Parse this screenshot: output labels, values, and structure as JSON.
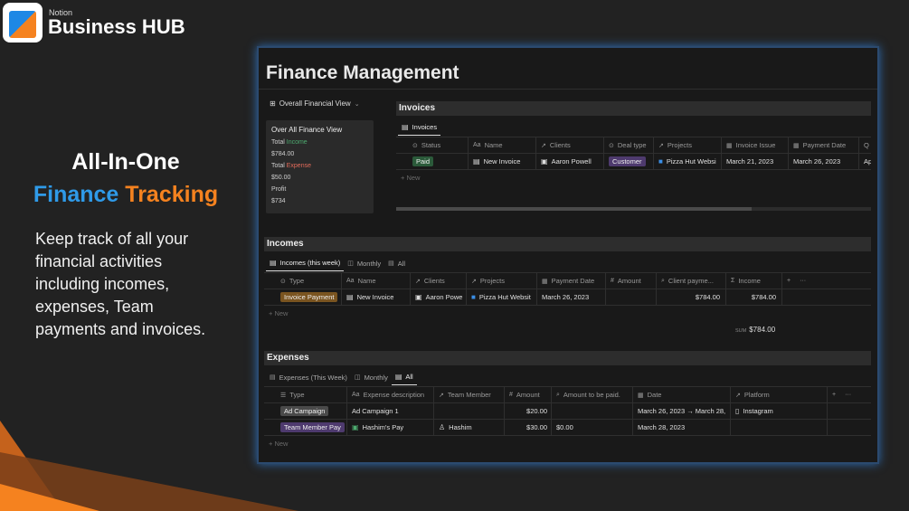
{
  "brand": {
    "small": "Notion",
    "name": "Business HUB"
  },
  "hero": {
    "line1": "All-In-One",
    "line2_a": "Finance",
    "line2_b": "Tracking",
    "description": "Keep track of all your financial activities including incomes, expenses, Team payments and invoices."
  },
  "colors": {
    "accent_blue": "#2f9ae8",
    "accent_orange": "#f5821f",
    "glow": "#2d6bb0"
  },
  "page": {
    "title": "Finance Management"
  },
  "overview": {
    "view_label": "Overall Financial View",
    "card_title": "Over All Finance View",
    "total_label": "Total",
    "income_word": "Income",
    "income_value": "$784.00",
    "expense_word": "Expense",
    "expense_value": "$50.00",
    "profit_label": "Profit",
    "profit_value": "$734"
  },
  "invoices": {
    "title": "Invoices",
    "view": "Invoices",
    "headers": [
      "Status",
      "Name",
      "Clients",
      "Deal type",
      "Projects",
      "Invoice Issue",
      "Payment Date",
      "Q"
    ],
    "row": {
      "status": "Paid",
      "name": "New Invoice",
      "client": "Aaron Powell",
      "deal": "Customer",
      "project": "Pizza Hut Websi",
      "issue": "March 21, 2023",
      "payment": "March 26, 2023",
      "extra": "Apr"
    },
    "new_label": "New"
  },
  "incomes": {
    "title": "Incomes",
    "views": [
      "Incomes (this week)",
      "Monthly",
      "All"
    ],
    "headers": [
      "Type",
      "Name",
      "Clients",
      "Projects",
      "Payment Date",
      "Amount",
      "Client payme...",
      "Income"
    ],
    "row": {
      "type": "Invoice Payment",
      "name": "New Invoice",
      "client": "Aaron Powe",
      "project": "Pizza Hut Websit",
      "date": "March 26, 2023",
      "amount": "",
      "client_payment": "$784.00",
      "income": "$784.00"
    },
    "new_label": "New",
    "sum_label": "SUM",
    "sum_value": "$784.00"
  },
  "expenses": {
    "title": "Expenses",
    "views": [
      "Expenses (This Week)",
      "Monthly",
      "All"
    ],
    "headers": [
      "Type",
      "Expense description",
      "Team Member",
      "Amount",
      "Amount to be paid.",
      "Date",
      "Platform"
    ],
    "rows": [
      {
        "type": "Ad Campaign",
        "desc": "Ad Campaign 1",
        "member": "",
        "amount": "$20.00",
        "to_pay": "",
        "date": "March 26, 2023 → March 28,",
        "platform": "Instagram"
      },
      {
        "type": "Team Member Pay",
        "desc": "Hashim's Pay",
        "member": "Hashim",
        "amount": "$30.00",
        "to_pay": "$0.00",
        "date": "March 28, 2023",
        "platform": ""
      }
    ],
    "new_label": "New"
  }
}
